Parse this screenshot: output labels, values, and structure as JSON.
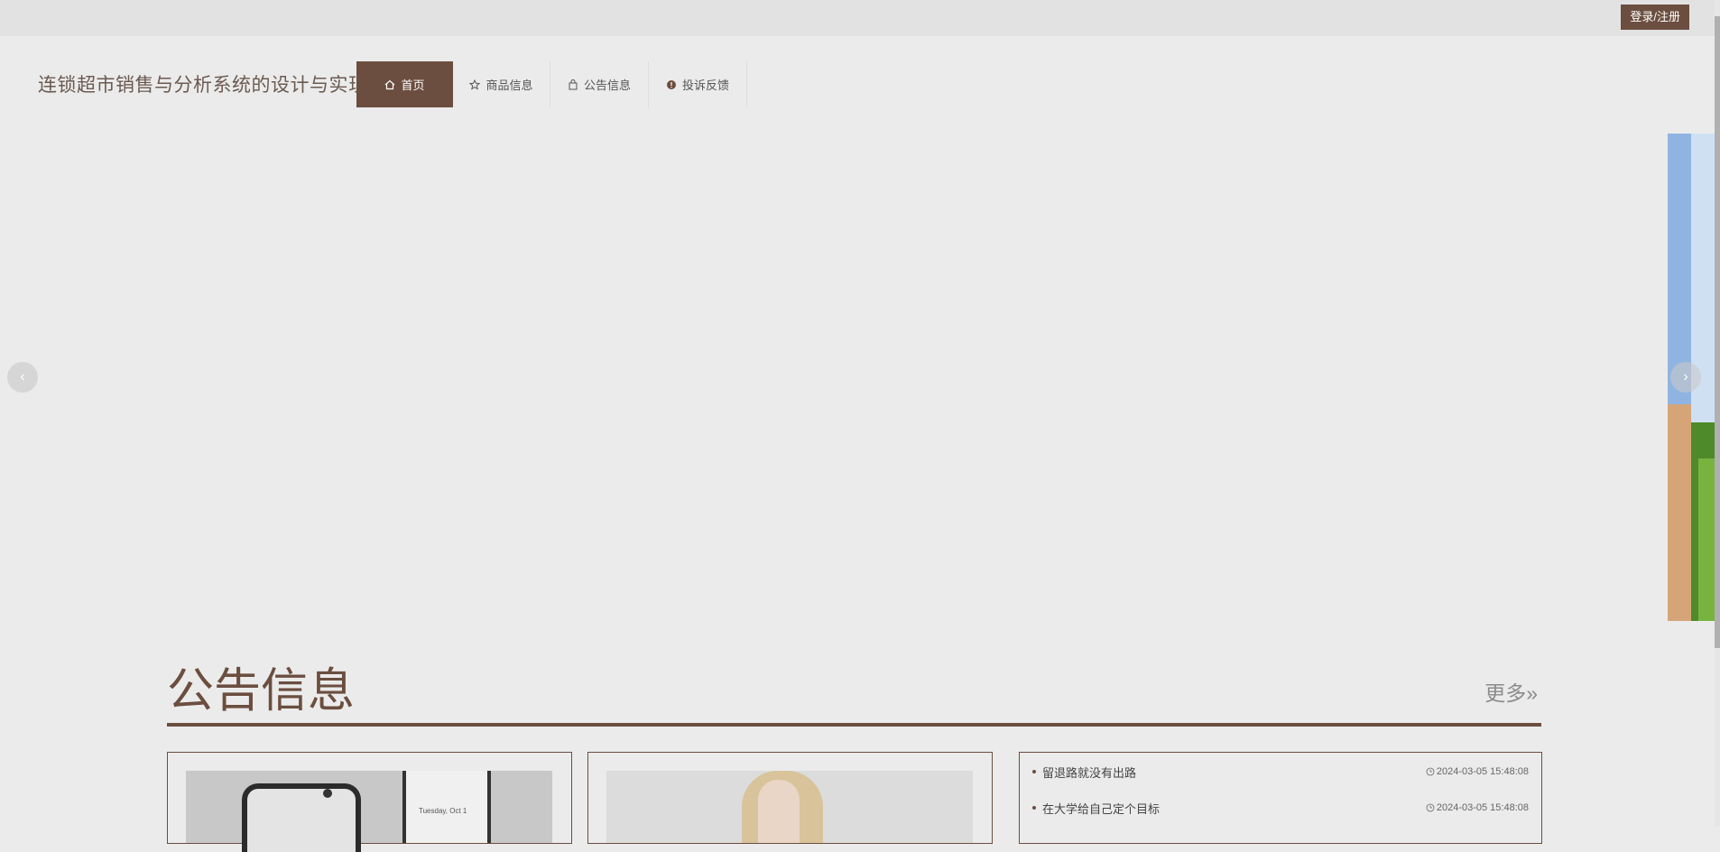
{
  "header": {
    "login_label": "登录/注册",
    "site_title": "连锁超市销售与分析系统的设计与实现"
  },
  "nav": {
    "items": [
      {
        "label": "首页",
        "icon": "home-icon",
        "active": true
      },
      {
        "label": "商品信息",
        "icon": "star-icon",
        "active": false
      },
      {
        "label": "公告信息",
        "icon": "bag-icon",
        "active": false
      },
      {
        "label": "投诉反馈",
        "icon": "alert-icon",
        "active": false
      }
    ]
  },
  "carousel": {
    "prev_icon": "chevron-left-icon",
    "next_icon": "chevron-right-icon"
  },
  "notice_section": {
    "title": "公告信息",
    "more_label": "更多»",
    "phone_text": "Tuesday, Oct 1"
  },
  "notice_list": [
    {
      "title": "留退路就没有出路",
      "time": "2024-03-05 15:48:08"
    },
    {
      "title": "在大学给自己定个目标",
      "time": "2024-03-05 15:48:08"
    }
  ],
  "colors": {
    "accent": "#6b4e3f",
    "background": "#ebebeb"
  }
}
